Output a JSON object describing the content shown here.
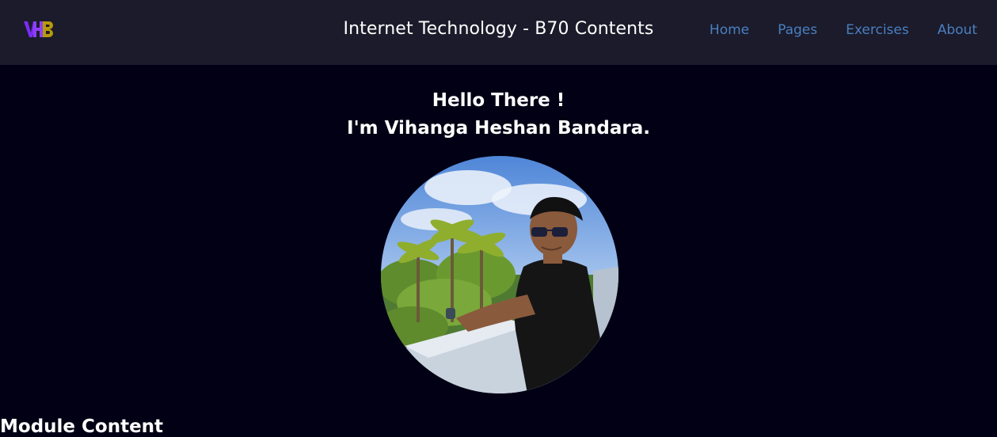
{
  "header": {
    "logo_text": "VHB",
    "title": "Internet Technology - B70 Contents",
    "nav": [
      {
        "label": "Home"
      },
      {
        "label": "Pages"
      },
      {
        "label": "Exercises"
      },
      {
        "label": "About"
      }
    ]
  },
  "hero": {
    "greeting": "Hello There !",
    "name_line": "I'm Vihanga Heshan Bandara."
  },
  "section": {
    "heading": "Module Content"
  },
  "colors": {
    "background": "#020014",
    "navbar": "#1b1b2b",
    "nav_link": "#4a7fc0",
    "logo_purple": "#7b2cf5",
    "logo_gold": "#b89a0a"
  }
}
